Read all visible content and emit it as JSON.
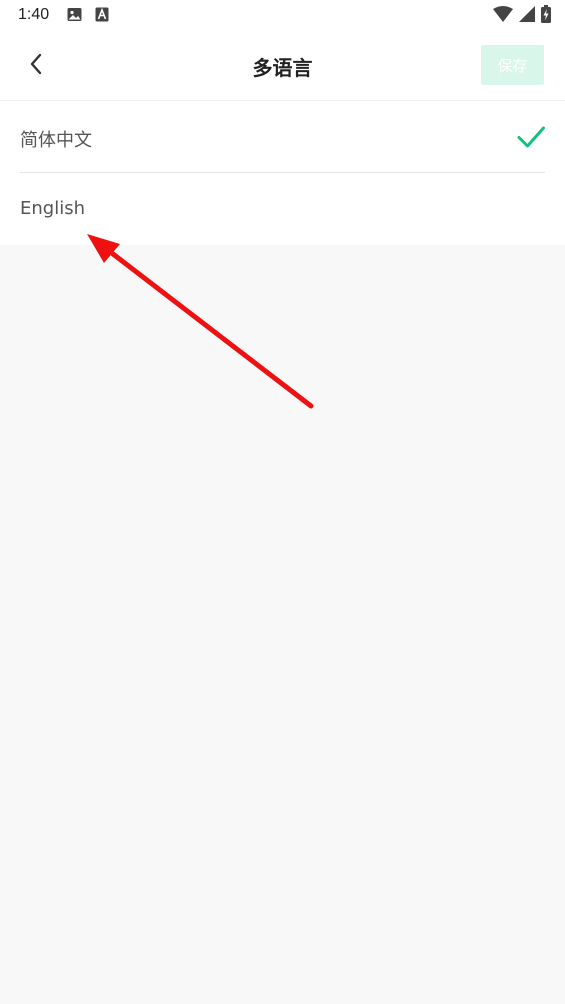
{
  "status_bar": {
    "time": "1:40",
    "left_icons": [
      "image-icon",
      "text-a-icon"
    ],
    "right_icons": [
      "wifi-icon",
      "signal-icon",
      "battery-charging-icon"
    ]
  },
  "header": {
    "back_icon": "chevron-left-icon",
    "title": "多语言",
    "save_label": "保存"
  },
  "languages": [
    {
      "label": "简体中文",
      "selected": true
    },
    {
      "label": "English",
      "selected": false
    }
  ],
  "colors": {
    "accent": "#14c07b",
    "save_button_bg": "#d8f6ea",
    "annotation_arrow": "#ee1111"
  }
}
